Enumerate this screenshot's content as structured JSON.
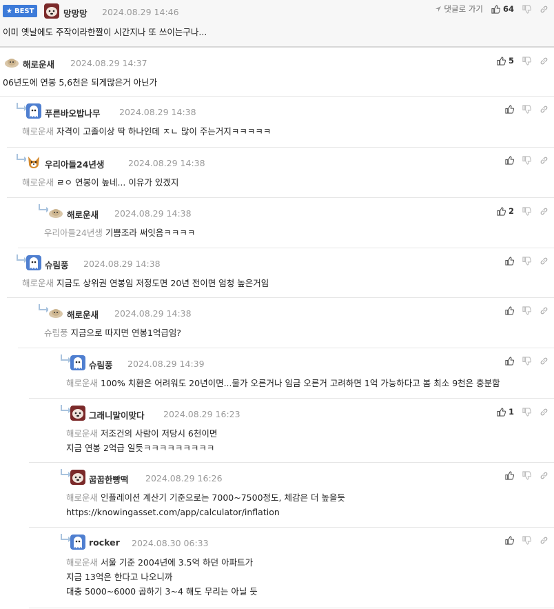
{
  "best": {
    "badge": "BEST",
    "nick": "망망망",
    "date": "2024.08.29 14:46",
    "reply_label": "댓글로 가기",
    "likes": "64",
    "text": "이미 옛날에도 주작이라한짤이 시간지나 또 쓰이는구나..."
  },
  "comments": [
    {
      "nick": "해로운새",
      "date": "2024.08.29 14:37",
      "likes": "5",
      "mention": "",
      "lines": [
        "06년도에 연봉 5,6천은 되게많은거 아닌가"
      ]
    },
    {
      "nick": "푸른바오밥나무",
      "date": "2024.08.29 14:38",
      "likes": "",
      "mention": "해로운새",
      "lines": [
        "자격이 고졸이상 딱 하나인데 ㅈㄴ 많이 주는거지ㅋㅋㅋㅋㅋ"
      ]
    },
    {
      "nick": "우리아들24년생",
      "date": "2024.08.29 14:38",
      "likes": "",
      "mention": "해로운새",
      "lines": [
        "ㄹㅇ 연봉이 높네... 이유가 있겠지"
      ]
    },
    {
      "nick": "해로운새",
      "date": "2024.08.29 14:38",
      "likes": "2",
      "mention": "우리아들24년생",
      "lines": [
        "기쁨조라 써잇음ㅋㅋㅋㅋ"
      ]
    },
    {
      "nick": "슈림풍",
      "date": "2024.08.29 14:38",
      "likes": "",
      "mention": "해로운새",
      "lines": [
        "지금도 상위권 연봉임 저정도면 20년 전이면 엄청 높은거임"
      ]
    },
    {
      "nick": "해로운새",
      "date": "2024.08.29 14:38",
      "likes": "",
      "mention": "슈림풍",
      "lines": [
        "지금으로 따지면 연봉1억급임?"
      ]
    },
    {
      "nick": "슈림풍",
      "date": "2024.08.29 14:39",
      "likes": "",
      "mention": "해로운새",
      "lines": [
        "100% 치환은 어려워도 20년이면...물가 오른거나 임금 오른거 고려하면 1억 가능하다고 봄 최소 9천은 충분함"
      ]
    },
    {
      "nick": "그래니말이맞다",
      "date": "2024.08.29 16:23",
      "likes": "1",
      "mention": "해로운새",
      "lines": [
        "저조건의 사람이 저당시 6천이면",
        "지금 연봉 2억급 일듯ㅋㅋㅋㅋㅋㅋㅋㅋㅋ"
      ]
    },
    {
      "nick": "꿉꿉한빵떡",
      "date": "2024.08.29 16:26",
      "likes": "",
      "mention": "해로운새",
      "lines": [
        "인플레이션 계산기 기준으로는 7000~7500정도, 체감은 더 높을듯",
        "https://knowingasset.com/app/calculator/inflation"
      ]
    },
    {
      "nick": "rocker",
      "date": "2024.08.30 06:33",
      "likes": "",
      "mention": "해로운새",
      "lines": [
        "서울 기준 2004년에 3.5억 하던 아파트가",
        "지금 13억은 한다고 나오니까",
        "대충 5000~6000 곱하기 3~4 해도 무리는 아닐 듯"
      ]
    }
  ]
}
